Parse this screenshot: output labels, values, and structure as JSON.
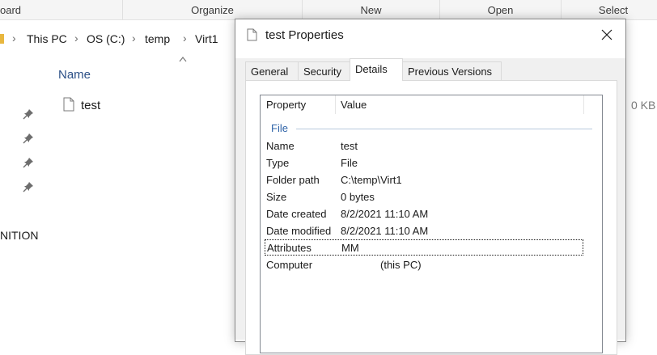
{
  "ribbon": {
    "groups": [
      "oard",
      "Organize",
      "New",
      "Open",
      "Select"
    ]
  },
  "address": {
    "crumbs": [
      "This PC",
      "OS (C:)",
      "temp",
      "Virt1"
    ]
  },
  "file_list": {
    "column_name": "Name",
    "file": {
      "name": "test",
      "size": "0 KB"
    }
  },
  "nav": {
    "partial_label": "NITION"
  },
  "dialog": {
    "title": "test Properties",
    "tabs": [
      {
        "label": "General",
        "active": false
      },
      {
        "label": "Security",
        "active": false
      },
      {
        "label": "Details",
        "active": true
      },
      {
        "label": "Previous Versions",
        "active": false
      }
    ],
    "details": {
      "header_property": "Property",
      "header_value": "Value",
      "group": "File",
      "rows": [
        {
          "key": "Name",
          "value": "test"
        },
        {
          "key": "Type",
          "value": "File"
        },
        {
          "key": "Folder path",
          "value": "C:\\temp\\Virt1"
        },
        {
          "key": "Size",
          "value": "0 bytes"
        },
        {
          "key": "Date created",
          "value": "8/2/2021 11:10 AM"
        },
        {
          "key": "Date modified",
          "value": "8/2/2021 11:10 AM"
        },
        {
          "key": "Attributes",
          "value": "MM"
        },
        {
          "key": "Computer",
          "value": "(this PC)"
        }
      ]
    }
  },
  "icons": {
    "pin": "pin-icon",
    "file": "file-icon",
    "close": "close-icon",
    "folder": "folder-icon"
  },
  "colors": {
    "link_blue": "#2b4f86",
    "group_blue": "#2f64a8",
    "dialog_bg": "#f0f0f0"
  }
}
